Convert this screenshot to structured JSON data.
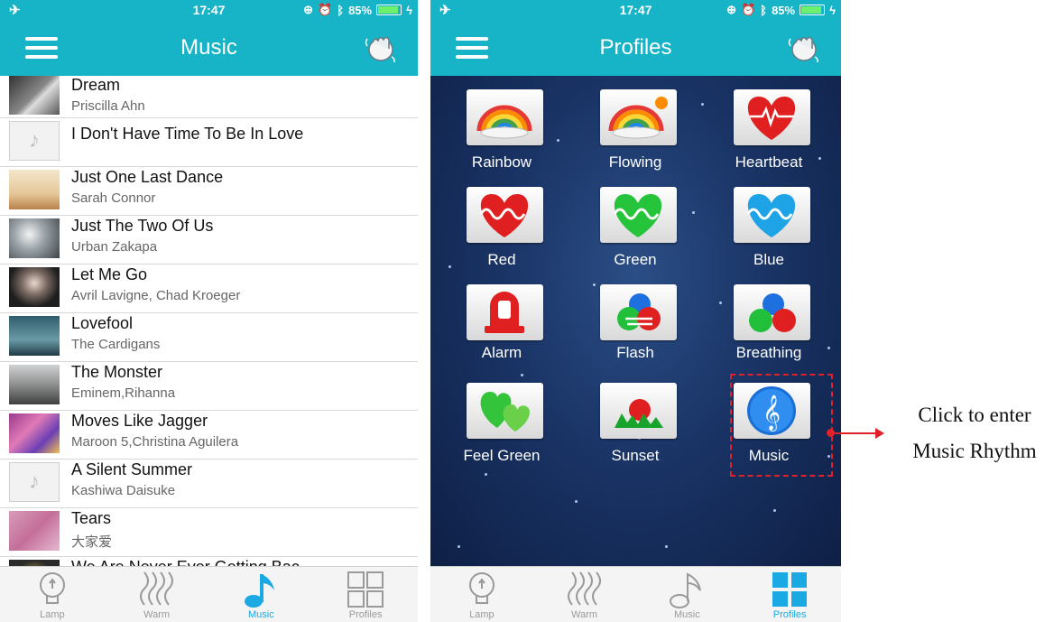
{
  "left_screen": {
    "status": {
      "time": "17:47",
      "battery": "85%"
    },
    "title": "Music",
    "songs": [
      {
        "title": "Dream",
        "artist": "Priscilla Ahn"
      },
      {
        "title": "I Don't Have Time To Be In Love",
        "artist": ""
      },
      {
        "title": "Just One Last Dance",
        "artist": "Sarah Connor"
      },
      {
        "title": "Just The Two Of Us",
        "artist": "Urban Zakapa"
      },
      {
        "title": "Let Me Go",
        "artist": "Avril Lavigne, Chad Kroeger"
      },
      {
        "title": "Lovefool",
        "artist": "The Cardigans"
      },
      {
        "title": "The Monster",
        "artist": "Eminem,Rihanna"
      },
      {
        "title": "Moves Like Jagger",
        "artist": "Maroon 5,Christina Aguilera"
      },
      {
        "title": "A Silent Summer",
        "artist": "Kashiwa Daisuke"
      },
      {
        "title": "Tears",
        "artist": "大家爱"
      },
      {
        "title": "We Are Never Ever Getting Bac...",
        "artist": ""
      }
    ],
    "tabs": [
      {
        "label": "Lamp",
        "icon": "bulb-icon"
      },
      {
        "label": "Warm",
        "icon": "heat-waves-icon"
      },
      {
        "label": "Music",
        "icon": "music-note-icon"
      },
      {
        "label": "Profiles",
        "icon": "grid-icon"
      }
    ],
    "active_tab": "Music"
  },
  "right_screen": {
    "status": {
      "time": "17:47",
      "battery": "85%"
    },
    "title": "Profiles",
    "profiles": [
      {
        "label": "Rainbow",
        "icon": "rainbow-icon"
      },
      {
        "label": "Flowing",
        "icon": "rainbow-sun-icon"
      },
      {
        "label": "Heartbeat",
        "icon": "heart-pulse-red-icon"
      },
      {
        "label": "Red",
        "icon": "heart-wave-red-icon"
      },
      {
        "label": "Green",
        "icon": "heart-wave-green-icon"
      },
      {
        "label": "Blue",
        "icon": "heart-wave-blue-icon"
      },
      {
        "label": "Alarm",
        "icon": "alarm-siren-icon"
      },
      {
        "label": "Flash",
        "icon": "color-balls-flash-icon"
      },
      {
        "label": "Breathing",
        "icon": "color-balls-icon"
      },
      {
        "label": "Feel Green",
        "icon": "green-hearts-icon"
      },
      {
        "label": "Sunset",
        "icon": "sunset-icon"
      },
      {
        "label": "Music",
        "icon": "treble-clef-icon"
      }
    ],
    "tabs": [
      {
        "label": "Lamp",
        "icon": "bulb-icon"
      },
      {
        "label": "Warm",
        "icon": "heat-waves-icon"
      },
      {
        "label": "Music",
        "icon": "music-note-icon"
      },
      {
        "label": "Profiles",
        "icon": "grid-icon"
      }
    ],
    "active_tab": "Profiles"
  },
  "annotation": {
    "line1": "Click to enter",
    "line2": "Music Rhythm"
  },
  "colors": {
    "header": "#17b3c6",
    "active_tab": "#1aa9e2",
    "annotation": "#e0202a"
  }
}
